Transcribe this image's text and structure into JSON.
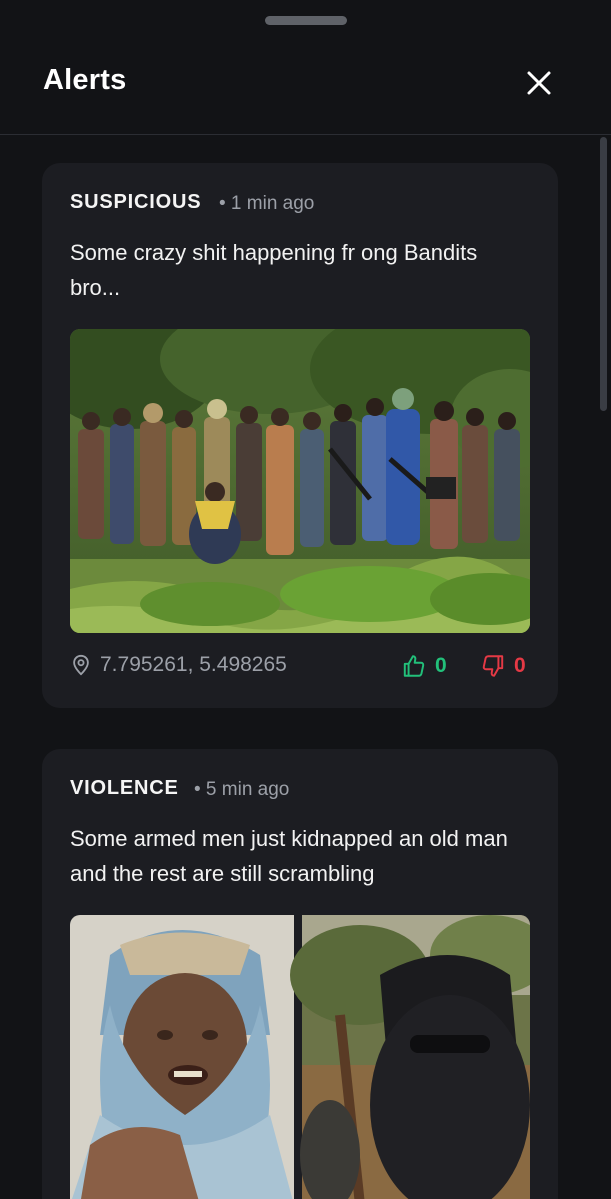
{
  "header": {
    "title": "Alerts"
  },
  "alerts": [
    {
      "category": "SUSPICIOUS",
      "time": "• 1 min ago",
      "description": "Some crazy shit happening fr ong Bandits bro...",
      "coordinates": "7.795261, 5.498265",
      "upvotes": "0",
      "downvotes": "0"
    },
    {
      "category": "VIOLENCE",
      "time": "• 5 min ago",
      "description": "Some armed men just kidnapped an old man and the rest are still scrambling"
    }
  ],
  "colors": {
    "background": "#121316",
    "card": "#1c1d22",
    "upvote": "#22c07a",
    "downvote": "#e53945",
    "muted_text": "#9ca0a8"
  },
  "icons": [
    "close-icon",
    "location-pin-icon",
    "thumbs-up-icon",
    "thumbs-down-icon"
  ]
}
